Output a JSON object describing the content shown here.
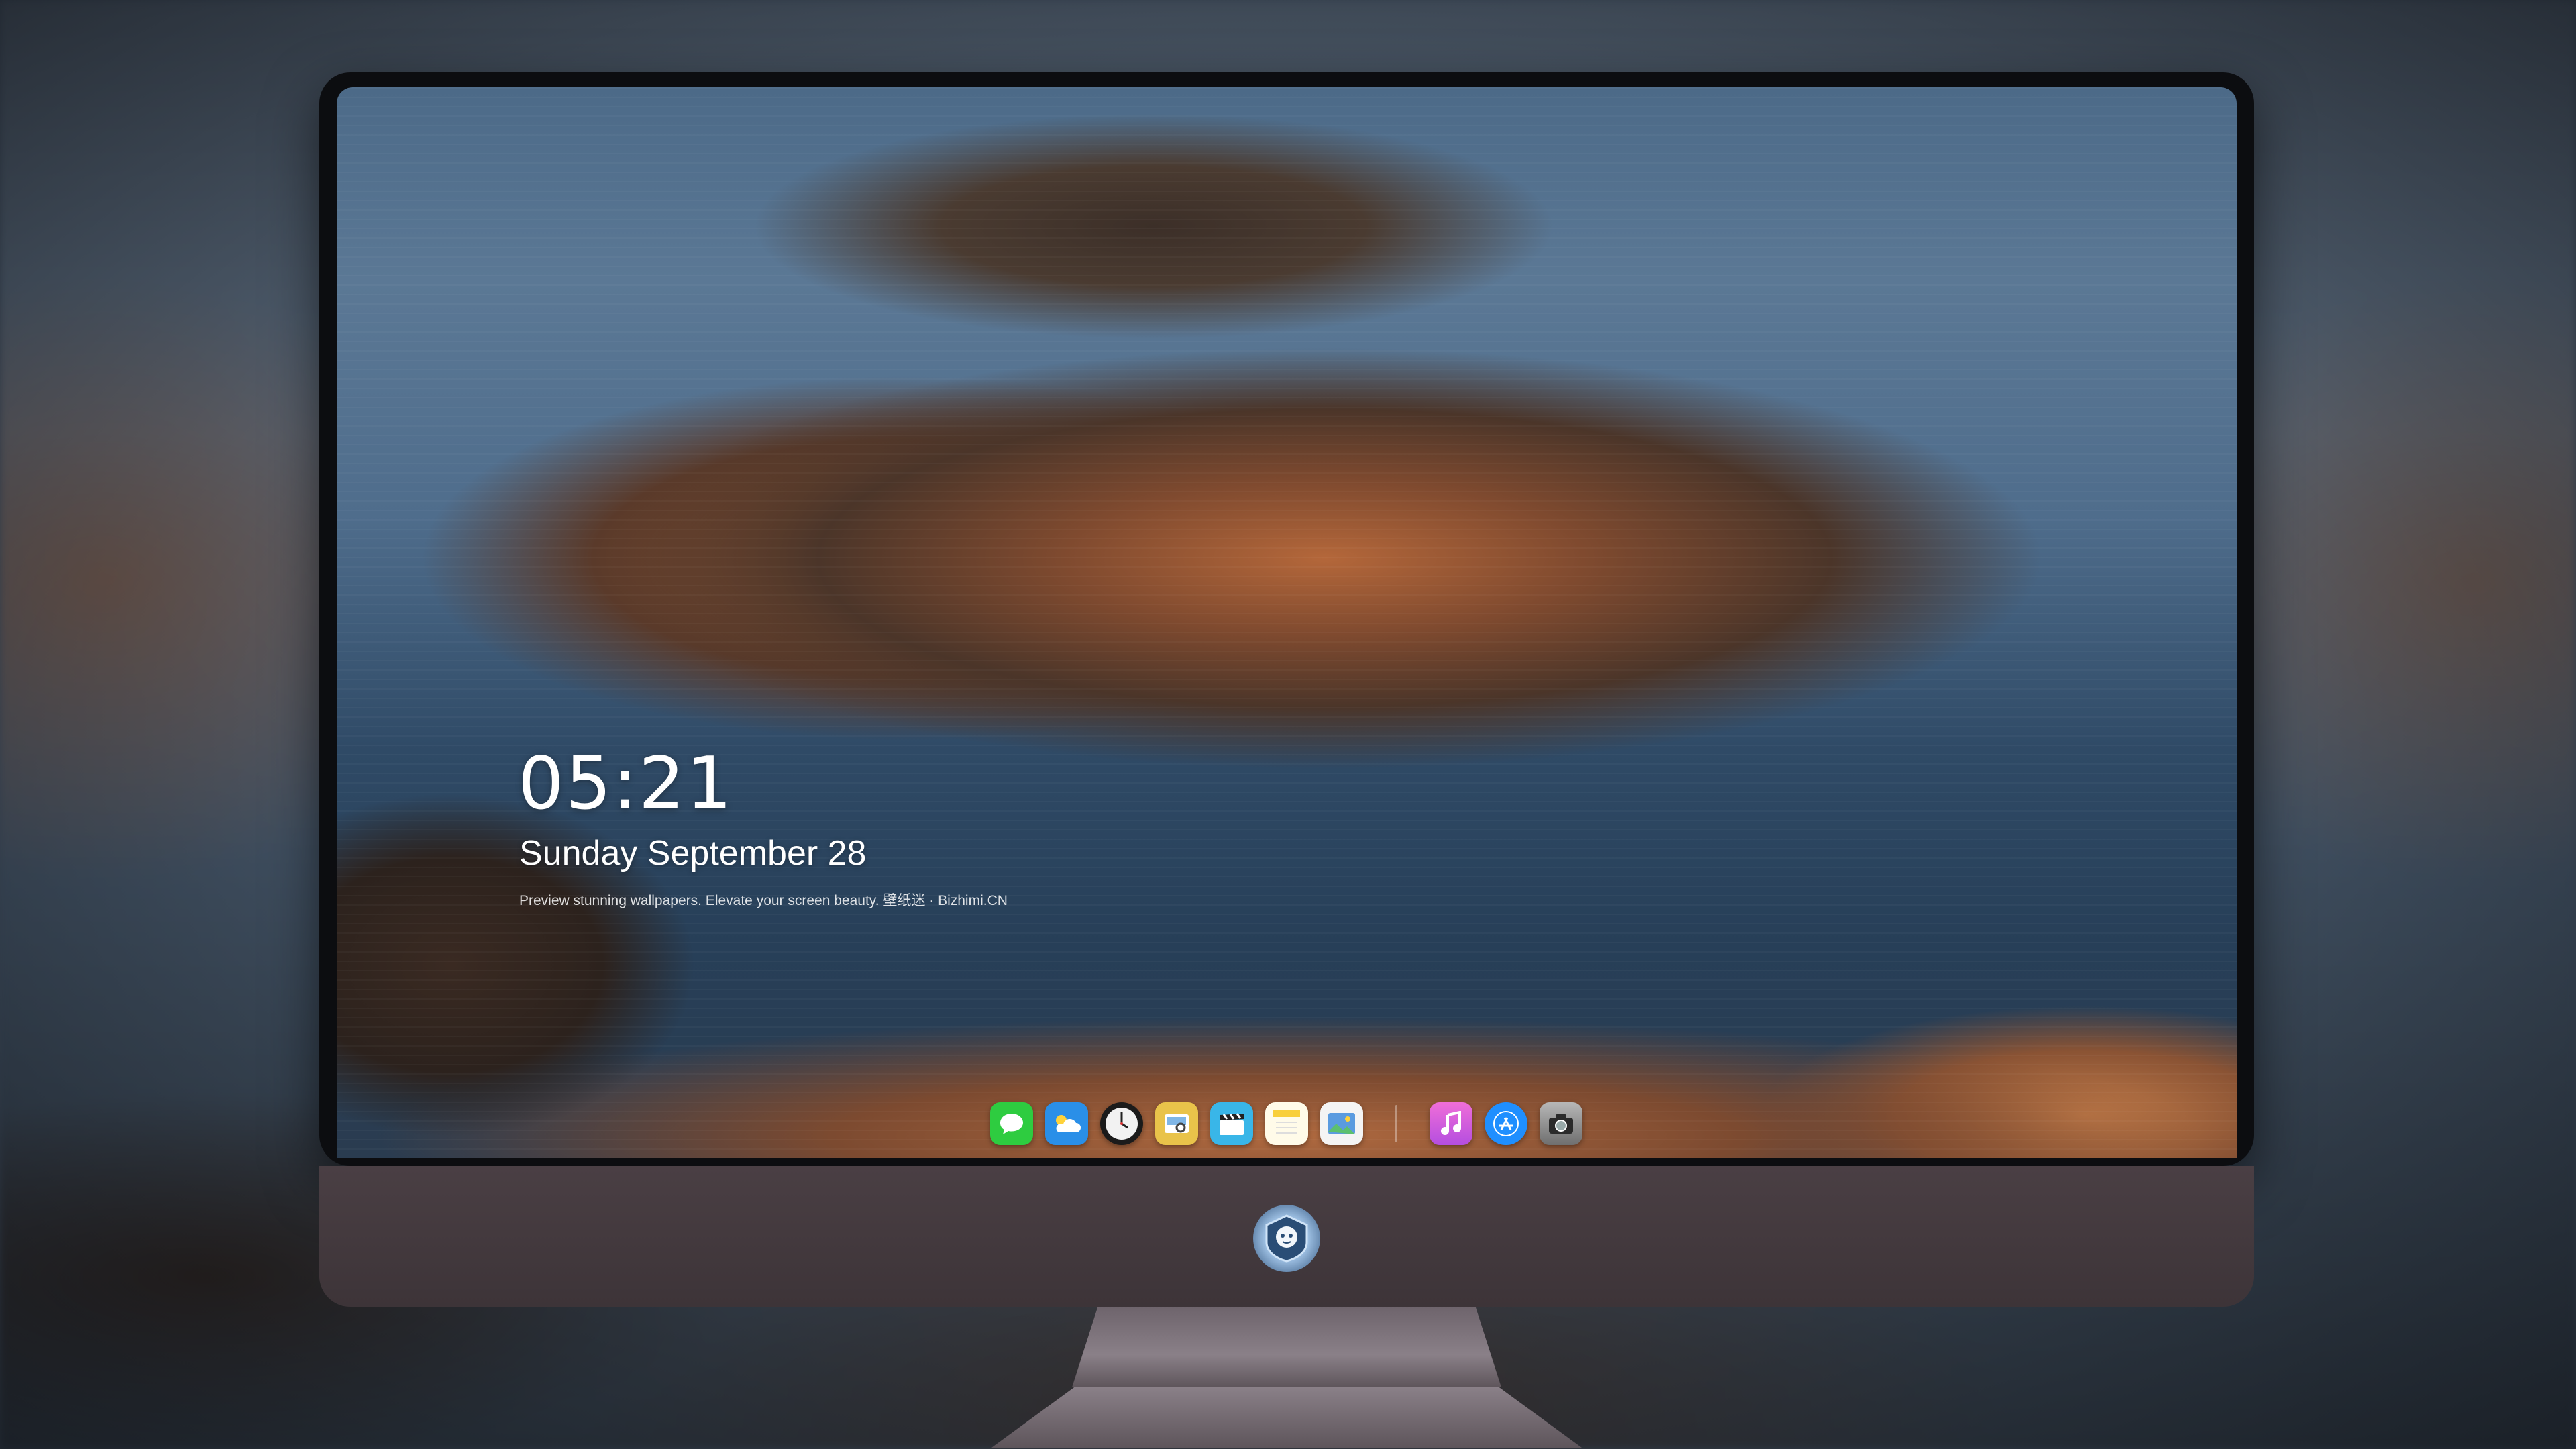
{
  "lock_screen": {
    "time": "05:21",
    "date": "Sunday September  28",
    "caption": "Preview stunning wallpapers. Elevate your screen beauty. 壁纸迷 · Bizhimi.CN"
  },
  "dock": {
    "apps": [
      {
        "name": "Messages",
        "icon": "chat-bubble-icon",
        "color": "#2ecc40"
      },
      {
        "name": "Weather",
        "icon": "cloud-icon",
        "color": "#2a8fe8"
      },
      {
        "name": "Clock",
        "icon": "clock-icon",
        "color": "#f2f2f2"
      },
      {
        "name": "Preview",
        "icon": "preview-icon",
        "color": "#e9c34a"
      },
      {
        "name": "Clips",
        "icon": "clapperboard-icon",
        "color": "#39b6e8"
      },
      {
        "name": "Notes",
        "icon": "notes-icon",
        "color": "#fde38a"
      },
      {
        "name": "Photos",
        "icon": "photos-icon",
        "color": "#5a9be0"
      },
      {
        "name": "iTunes",
        "icon": "music-note-icon",
        "color": "#e04fd0"
      },
      {
        "name": "App Store",
        "icon": "app-store-icon",
        "color": "#1f8fff"
      },
      {
        "name": "Camera",
        "icon": "camera-icon",
        "color": "#8a8a8a"
      }
    ]
  },
  "monitor": {
    "logo_icon": "mascot-logo-icon"
  }
}
